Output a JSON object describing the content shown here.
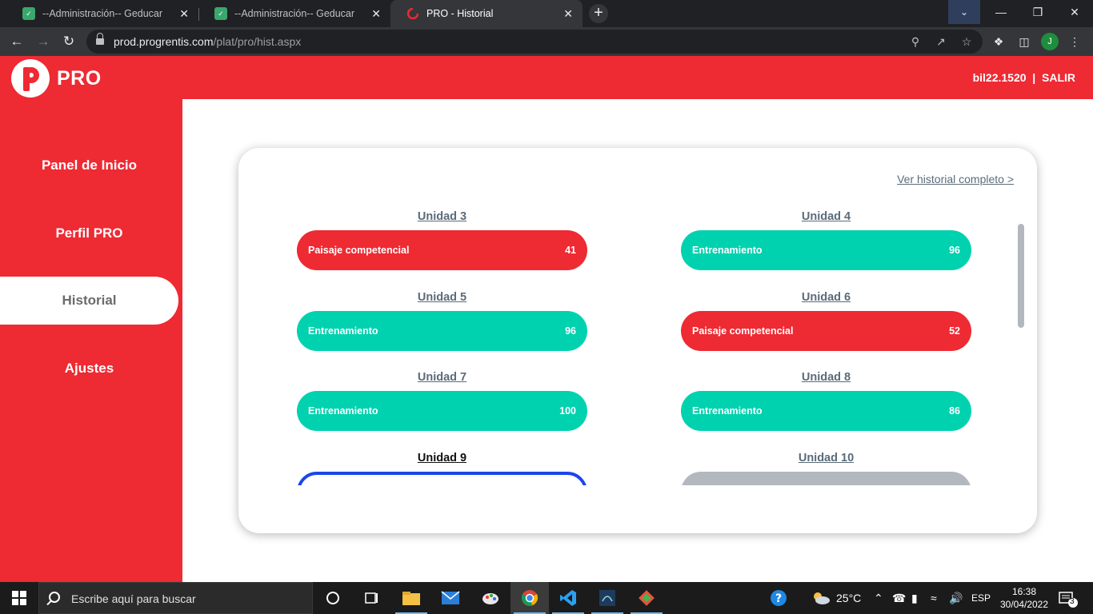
{
  "browser": {
    "tabs": [
      {
        "title": "--Administración-- Geducar",
        "active": false
      },
      {
        "title": "--Administración-- Geducar",
        "active": false
      },
      {
        "title": "PRO - Historial",
        "active": true
      }
    ],
    "url_host": "prod.progrentis.com",
    "url_path": "/plat/pro/hist.aspx",
    "profile_initial": "J",
    "new_tab_label": "+"
  },
  "header": {
    "logo_text": "PRO",
    "username": "bil22.1520",
    "separator": "|",
    "logout_label": "SALIR"
  },
  "sidebar": {
    "items": [
      {
        "label": "Panel de Inicio",
        "active": false
      },
      {
        "label": "Perfil PRO",
        "active": false
      },
      {
        "label": "Historial",
        "active": true
      },
      {
        "label": "Ajustes",
        "active": false
      }
    ]
  },
  "history": {
    "full_history_link": "Ver historial completo >",
    "units": [
      {
        "title": "Unidad 3",
        "activity": "Paisaje competencial",
        "score": "41",
        "status": "red"
      },
      {
        "title": "Unidad 4",
        "activity": "Entrenamiento",
        "score": "96",
        "status": "teal"
      },
      {
        "title": "Unidad 5",
        "activity": "Entrenamiento",
        "score": "96",
        "status": "teal"
      },
      {
        "title": "Unidad 6",
        "activity": "Paisaje competencial",
        "score": "52",
        "status": "red"
      },
      {
        "title": "Unidad 7",
        "activity": "Entrenamiento",
        "score": "100",
        "status": "teal"
      },
      {
        "title": "Unidad 8",
        "activity": "Entrenamiento",
        "score": "86",
        "status": "teal"
      },
      {
        "title": "Unidad 9",
        "activity": "",
        "score": "",
        "status": "outline"
      },
      {
        "title": "Unidad 10",
        "activity": "",
        "score": "",
        "status": "gray"
      }
    ]
  },
  "colors": {
    "brand_red": "#ee2a33",
    "teal": "#00d2b0",
    "current_outline": "#1a47e8",
    "locked_gray": "#b3b8be"
  },
  "taskbar": {
    "search_placeholder": "Escribe aquí para buscar",
    "weather": "25°C",
    "language": "ESP",
    "time": "16:38",
    "date": "30/04/2022",
    "notifications": "3"
  }
}
